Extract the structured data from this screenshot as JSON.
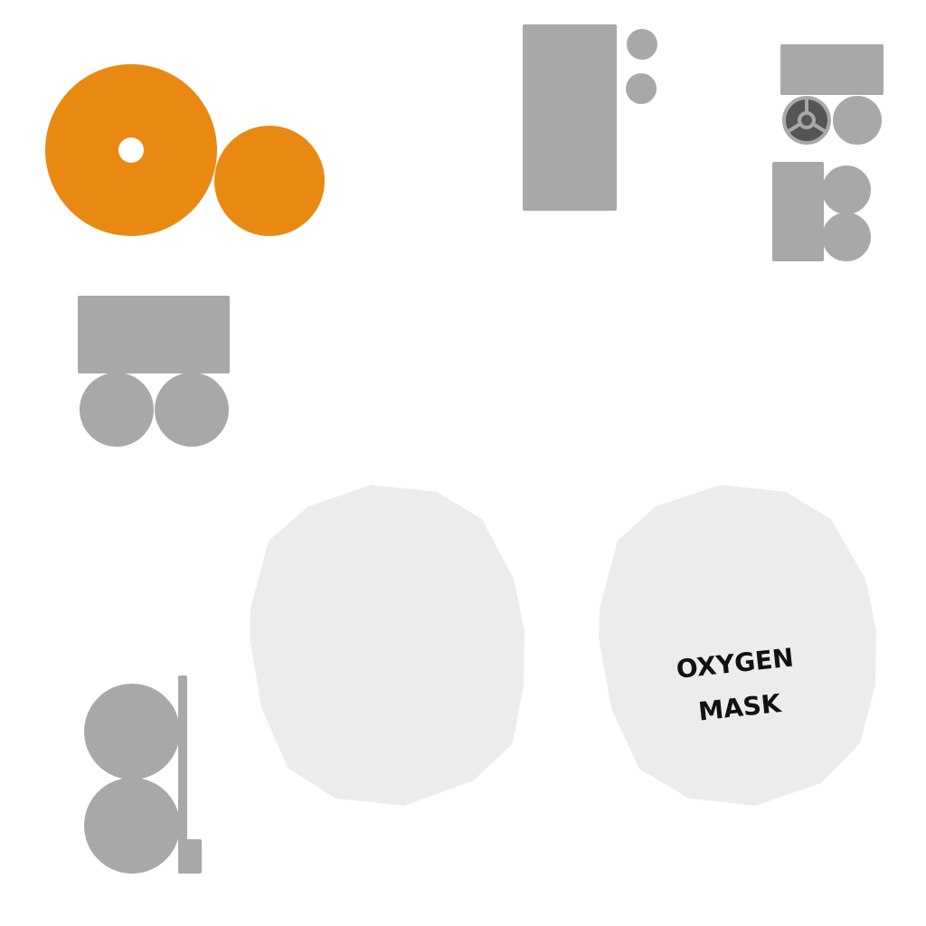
{
  "colors": {
    "background": "#ffffff",
    "highlight": "#e98912",
    "prop": "#a8a8a8",
    "mask_body": "#ececec",
    "valve": "#555555",
    "label": "#111111"
  },
  "sprites": {
    "orange_reel": {
      "name": "highlighted-reel",
      "icon": "reel-icon"
    },
    "tall_cabinet": {
      "name": "tall-cabinet-with-knobs"
    },
    "cart_with_valve": {
      "name": "cart-with-valve",
      "icon": "valve-icon"
    },
    "stacked_tanks": {
      "name": "stacked-tanks"
    },
    "wheeled_cart": {
      "name": "wheeled-cart"
    },
    "cylinder_stand": {
      "name": "cylinder-stand"
    },
    "mask_blank": {
      "name": "blank-mask-sprite"
    },
    "mask_labeled": {
      "name": "oxygen-mask-sprite",
      "label_line1": "OXYGEN",
      "label_line2": "MASK"
    }
  }
}
